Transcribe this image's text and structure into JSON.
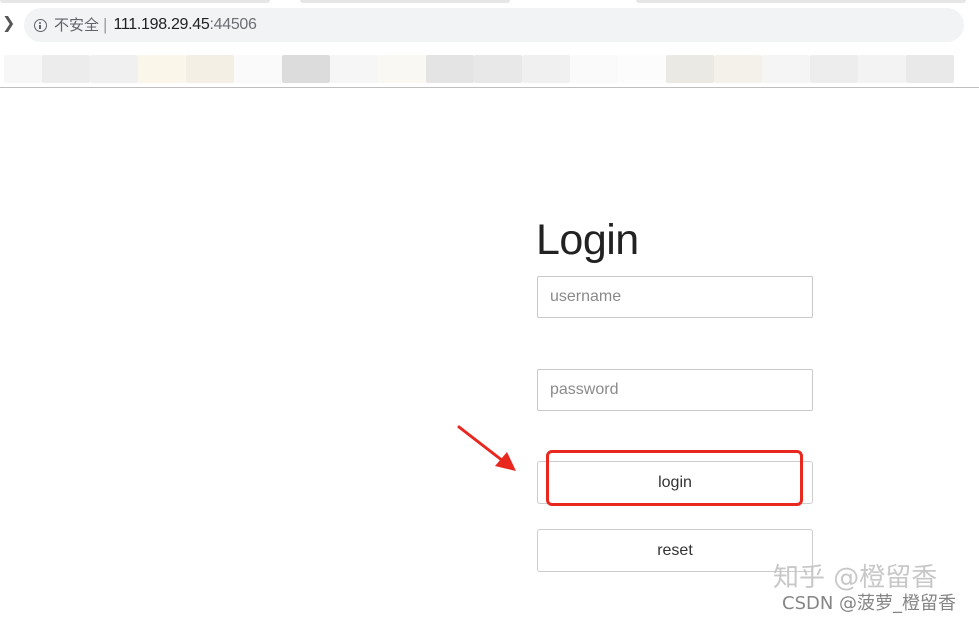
{
  "browser": {
    "security_label": "不安全",
    "separator": "|",
    "url_host": "111.198.29.45",
    "url_port": ":44506"
  },
  "login": {
    "title": "Login",
    "username_placeholder": "username",
    "password_placeholder": "password",
    "login_label": "login",
    "reset_label": "reset"
  },
  "annotations": {
    "highlight_color": "#e8271f",
    "arrow_color": "#e8271f"
  },
  "watermark": {
    "zhihu": "知乎 @橙留香",
    "csdn": "CSDN @菠萝_橙留香"
  },
  "colors": {
    "address_bar_bg": "#f1f3f4",
    "border": "#cccccc",
    "text": "#333333"
  }
}
